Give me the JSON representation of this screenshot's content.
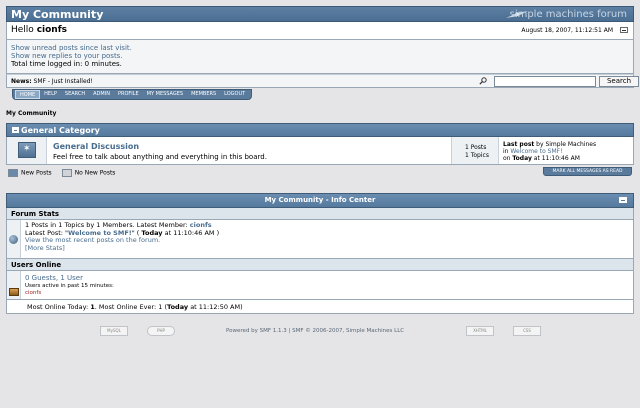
{
  "header": {
    "title": "My Community",
    "logo_text": "simple machines forum"
  },
  "user": {
    "hello_prefix": "Hello ",
    "username": "cionfs",
    "datetime": "August 18, 2007, 11:12:51 AM"
  },
  "userinfo": {
    "unread_link": "Show unread posts since last visit.",
    "replies_link": "Show new replies to your posts.",
    "total_time": "Total time logged in: 0 minutes."
  },
  "news": {
    "label": "News:",
    "text": " SMF - Just Installed!"
  },
  "search": {
    "placeholder": "",
    "button_label": "Search"
  },
  "menu": [
    "HOME",
    "HELP",
    "SEARCH",
    "ADMIN",
    "PROFILE",
    "MY MESSAGES",
    "MEMBERS",
    "LOGOUT"
  ],
  "breadcrumb": "My Community",
  "category": {
    "name": "General Category",
    "board": {
      "name": "General Discussion",
      "description": "Feel free to talk about anything and everything in this board.",
      "posts": "1 Posts",
      "topics": "1 Topics",
      "last_post_label": "Last post",
      "last_post_by": " by Simple Machines",
      "in_label": "in ",
      "last_topic": "Welcome to SMF!",
      "on_label": "on ",
      "today": "Today",
      "time": " at 11:10:46 AM"
    }
  },
  "legend": {
    "new_posts": "New Posts",
    "no_new_posts": "No New Posts"
  },
  "mark_read_label": "MARK ALL MESSAGES AS READ",
  "info_center": {
    "title": "My Community - Info Center",
    "forum_stats": {
      "heading": "Forum Stats",
      "line1_prefix": "1 Posts in 1 Topics by 1 Members. Latest Member: ",
      "latest_member": "cionfs",
      "latest_post_prefix": "Latest Post: \"",
      "latest_post_title": "Welcome to SMF!",
      "latest_post_mid": "\" ( ",
      "latest_post_today": "Today",
      "latest_post_time": " at 11:10:46 AM )",
      "recent_link": "View the most recent posts on the forum.",
      "more_stats": "[More Stats]"
    },
    "users_online": {
      "heading": "Users Online",
      "summary": "0 Guests, 1 User",
      "active_text": "Users active in past 15 minutes:",
      "online_user": "cionfs",
      "most_prefix": "Most Online Today: ",
      "most_today": "1",
      "most_mid": ". Most Online Ever: 1 (",
      "most_today_word": "Today",
      "most_time": " at 11:12:50 AM)"
    }
  },
  "footer": {
    "powered": "Powered by SMF 1.1.3 | SMF © 2006-2007, Simple Machines LLC",
    "badges": [
      "MySQL",
      "PHP",
      "XHTML",
      "CSS"
    ]
  }
}
